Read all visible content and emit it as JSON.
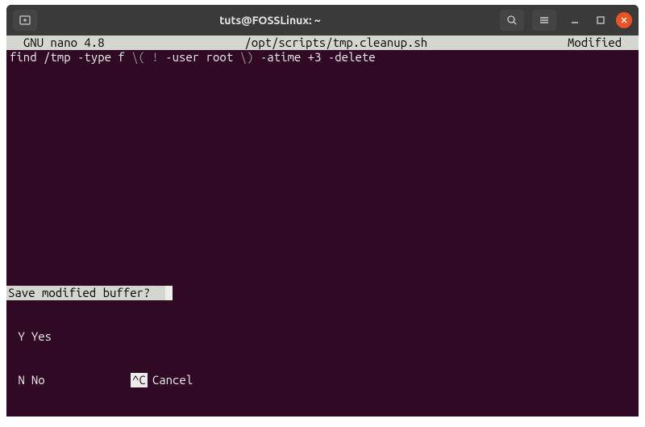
{
  "titlebar": {
    "title": "tuts@FOSSLinux: ~"
  },
  "nano": {
    "app": "  GNU nano 4.8",
    "file": "/opt/scripts/tmp.cleanup.sh",
    "status": "Modified  "
  },
  "code": {
    "p1": "find /tmp -type f ",
    "p2": "\\( !",
    "p3": " -user root ",
    "p4": "\\)",
    "p5": " -atime +3 -delete"
  },
  "prompt": {
    "question": "Save modified buffer?  "
  },
  "shortcuts": {
    "yes_key": " Y",
    "yes_label": "Yes",
    "no_key": " N",
    "no_label": "No",
    "cancel_key": "^C",
    "cancel_label": "Cancel"
  }
}
